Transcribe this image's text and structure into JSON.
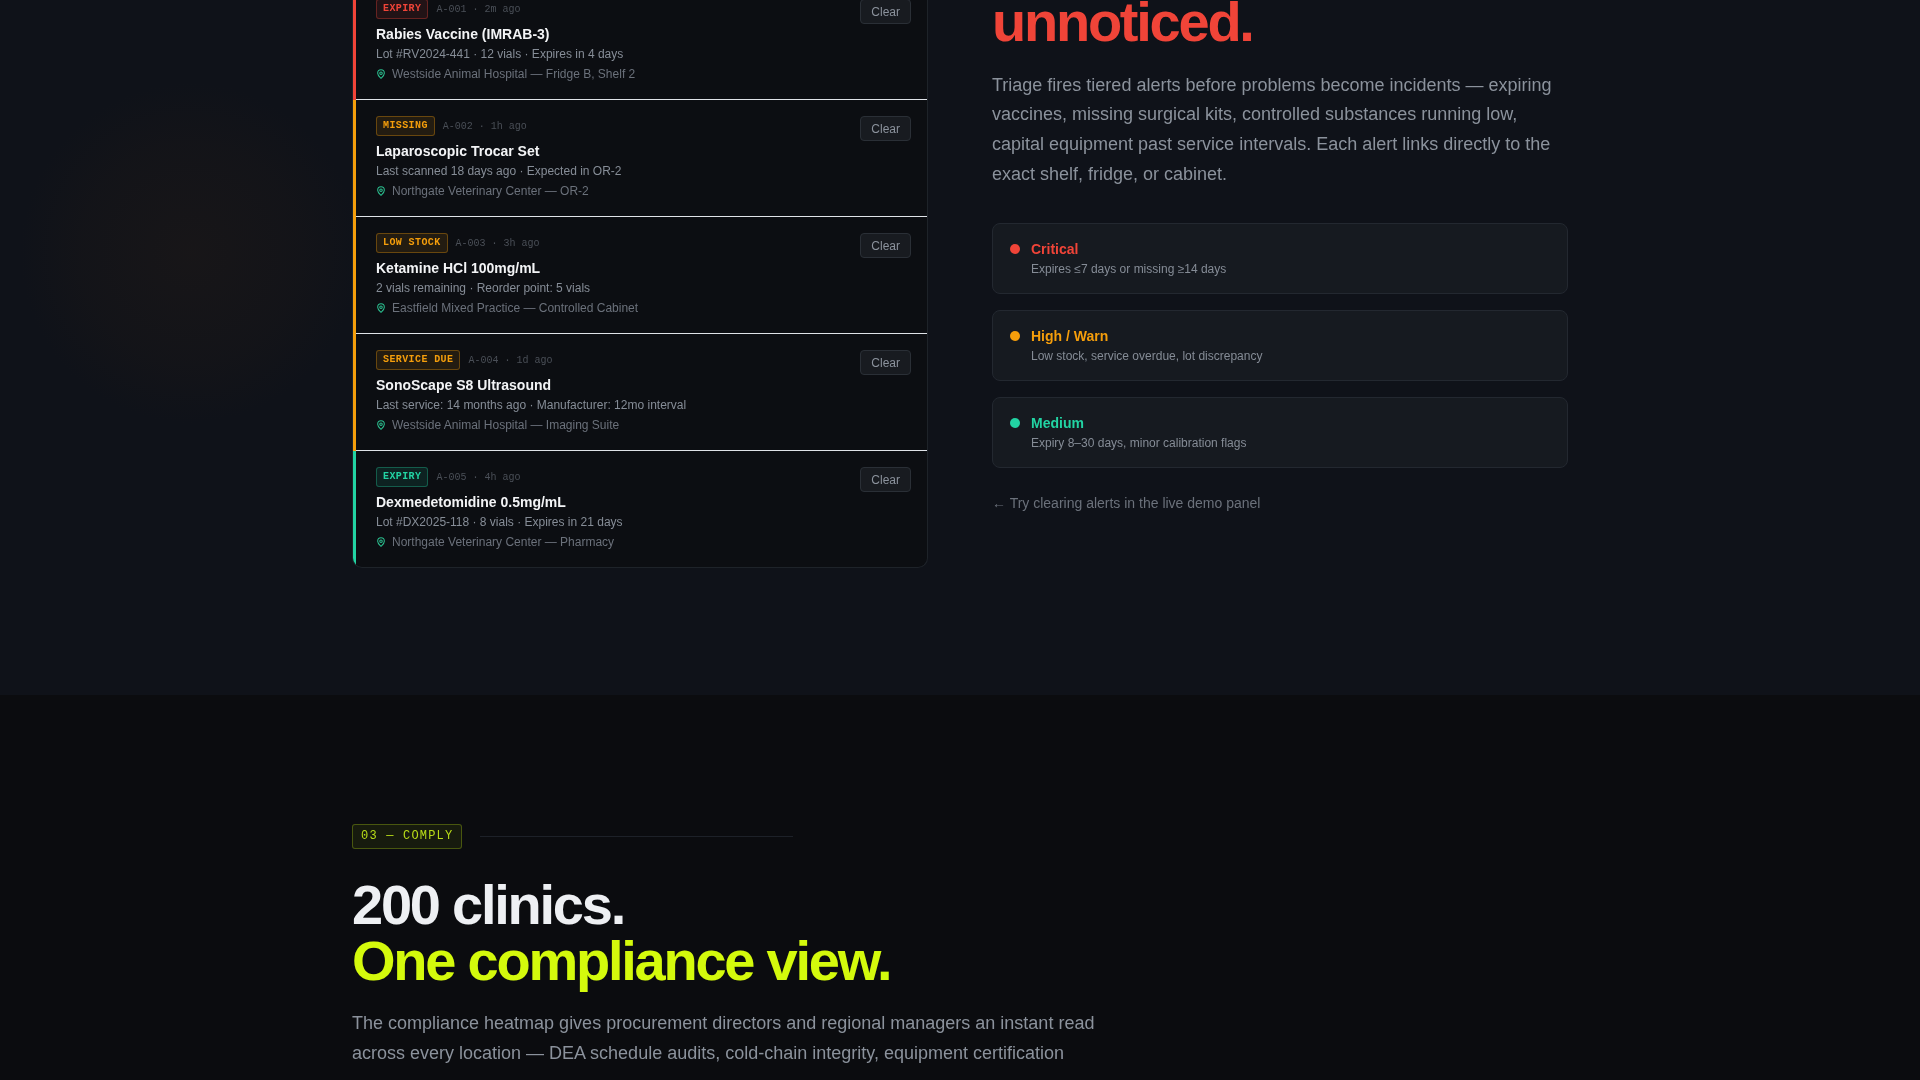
{
  "alerts": [
    {
      "badge": "EXPIRY",
      "meta": "A-001 · 2m ago",
      "title": "Rabies Vaccine (IMRAB-3)",
      "detail": "Lot #RV2024-441 · 12 vials · Expires in 4 days",
      "location": "Westside Animal Hospital — Fridge B, Shelf 2",
      "color": "#f04438",
      "action": "Clear"
    },
    {
      "badge": "MISSING",
      "meta": "A-002 · 1h ago",
      "title": "Laparoscopic Trocar Set",
      "detail": "Last scanned 18 days ago · Expected in OR-2",
      "location": "Northgate Veterinary Center — OR-2",
      "color": "#f59e0b",
      "action": "Clear"
    },
    {
      "badge": "LOW STOCK",
      "meta": "A-003 · 3h ago",
      "title": "Ketamine HCl 100mg/mL",
      "detail": "2 vials remaining · Reorder point: 5 vials",
      "location": "Eastfield Mixed Practice — Controlled Cabinet",
      "color": "#f59e0b",
      "action": "Clear"
    },
    {
      "badge": "SERVICE DUE",
      "meta": "A-004 · 1d ago",
      "title": "SonoScape S8 Ultrasound",
      "detail": "Last service: 14 months ago · Manufacturer: 12mo interval",
      "location": "Westside Animal Hospital — Imaging Suite",
      "color": "#f59e0b",
      "action": "Clear"
    },
    {
      "badge": "EXPIRY",
      "meta": "A-005 · 4h ago",
      "title": "Dexmedetomidine 0.5mg/mL",
      "detail": "Lot #DX2025-118 · 8 vials · Expires in 21 days",
      "location": "Northgate Veterinary Center — Pharmacy",
      "color": "#22d3a3",
      "action": "Clear"
    }
  ],
  "triage": {
    "heading": "unnoticed.",
    "body": "Triage fires tiered alerts before problems become incidents — expiring vaccines, missing surgical kits, controlled substances running low, capital equipment past service intervals. Each alert links directly to the exact shelf, fridge, or cabinet.",
    "severity_levels": [
      {
        "label": "Critical",
        "description": "Expires ≤7 days or missing ≥14 days",
        "color": "#f04438"
      },
      {
        "label": "High / Warn",
        "description": "Low stock, service overdue, lot discrepancy",
        "color": "#f59e0b"
      },
      {
        "label": "Medium",
        "description": "Expiry 8–30 days, minor calibration flags",
        "color": "#22d3a3"
      }
    ],
    "hint": "← Try clearing alerts in the live demo panel"
  },
  "comply": {
    "tag": "03 — COMPLY",
    "heading": "200 clinics.",
    "heading_accent": "One compliance view.",
    "body": "The compliance heatmap gives procurement directors and regional managers an instant read across every location — DEA schedule audits, cold-chain integrity, equipment certification"
  }
}
